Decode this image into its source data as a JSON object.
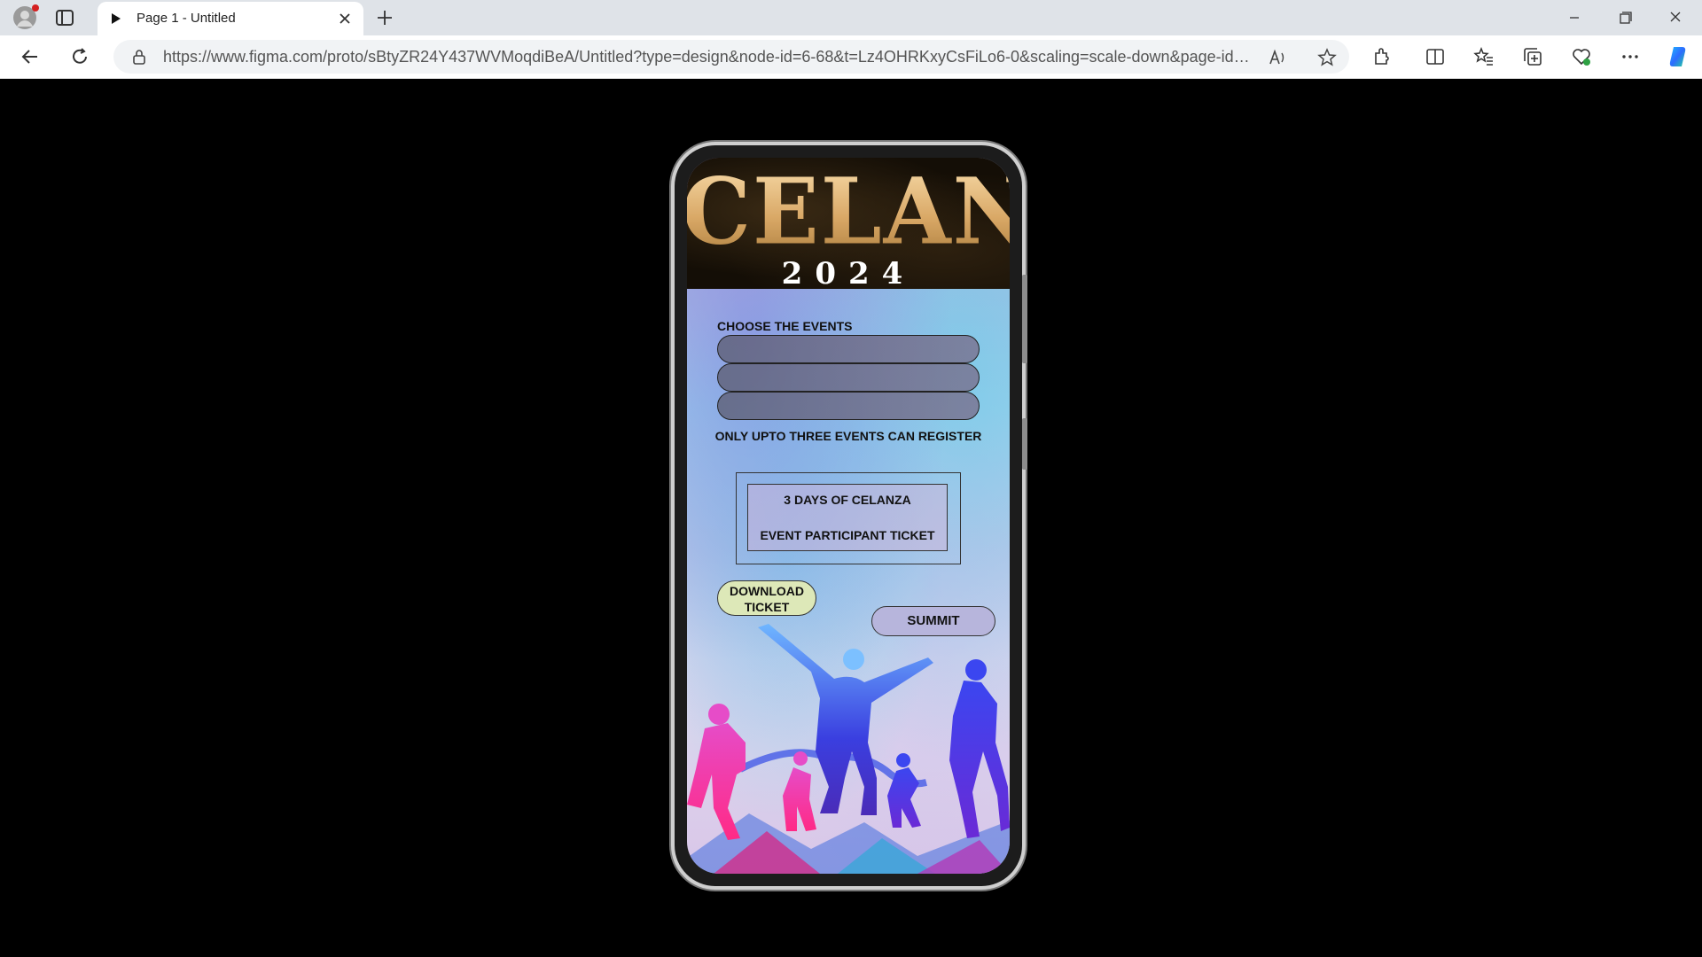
{
  "browser": {
    "tab_title": "Page 1 - Untitled",
    "url": "https://www.figma.com/proto/sBtyZR24Y437WVMoqdiBeA/Untitled?type=design&node-id=6-68&t=Lz4OHRKxyCsFiLo6-0&scaling=scale-down&page-id=0..."
  },
  "app": {
    "brand": "CELANZA",
    "year": "2024",
    "choose_label": "CHOOSE THE EVENTS",
    "event_fields": [
      "",
      "",
      ""
    ],
    "note": "ONLY UPTO THREE EVENTS CAN REGISTER",
    "ticket": {
      "line1": "3 DAYS OF CELANZA",
      "line2": "EVENT PARTICIPANT TICKET"
    },
    "download_label_1": "DOWNLOAD",
    "download_label_2": "TICKET",
    "submit_label": "SUMMIT"
  },
  "colors": {
    "header_gold": "#d9a866",
    "download_button": "#dde8b8",
    "submit_button": "#b7b5dc"
  }
}
